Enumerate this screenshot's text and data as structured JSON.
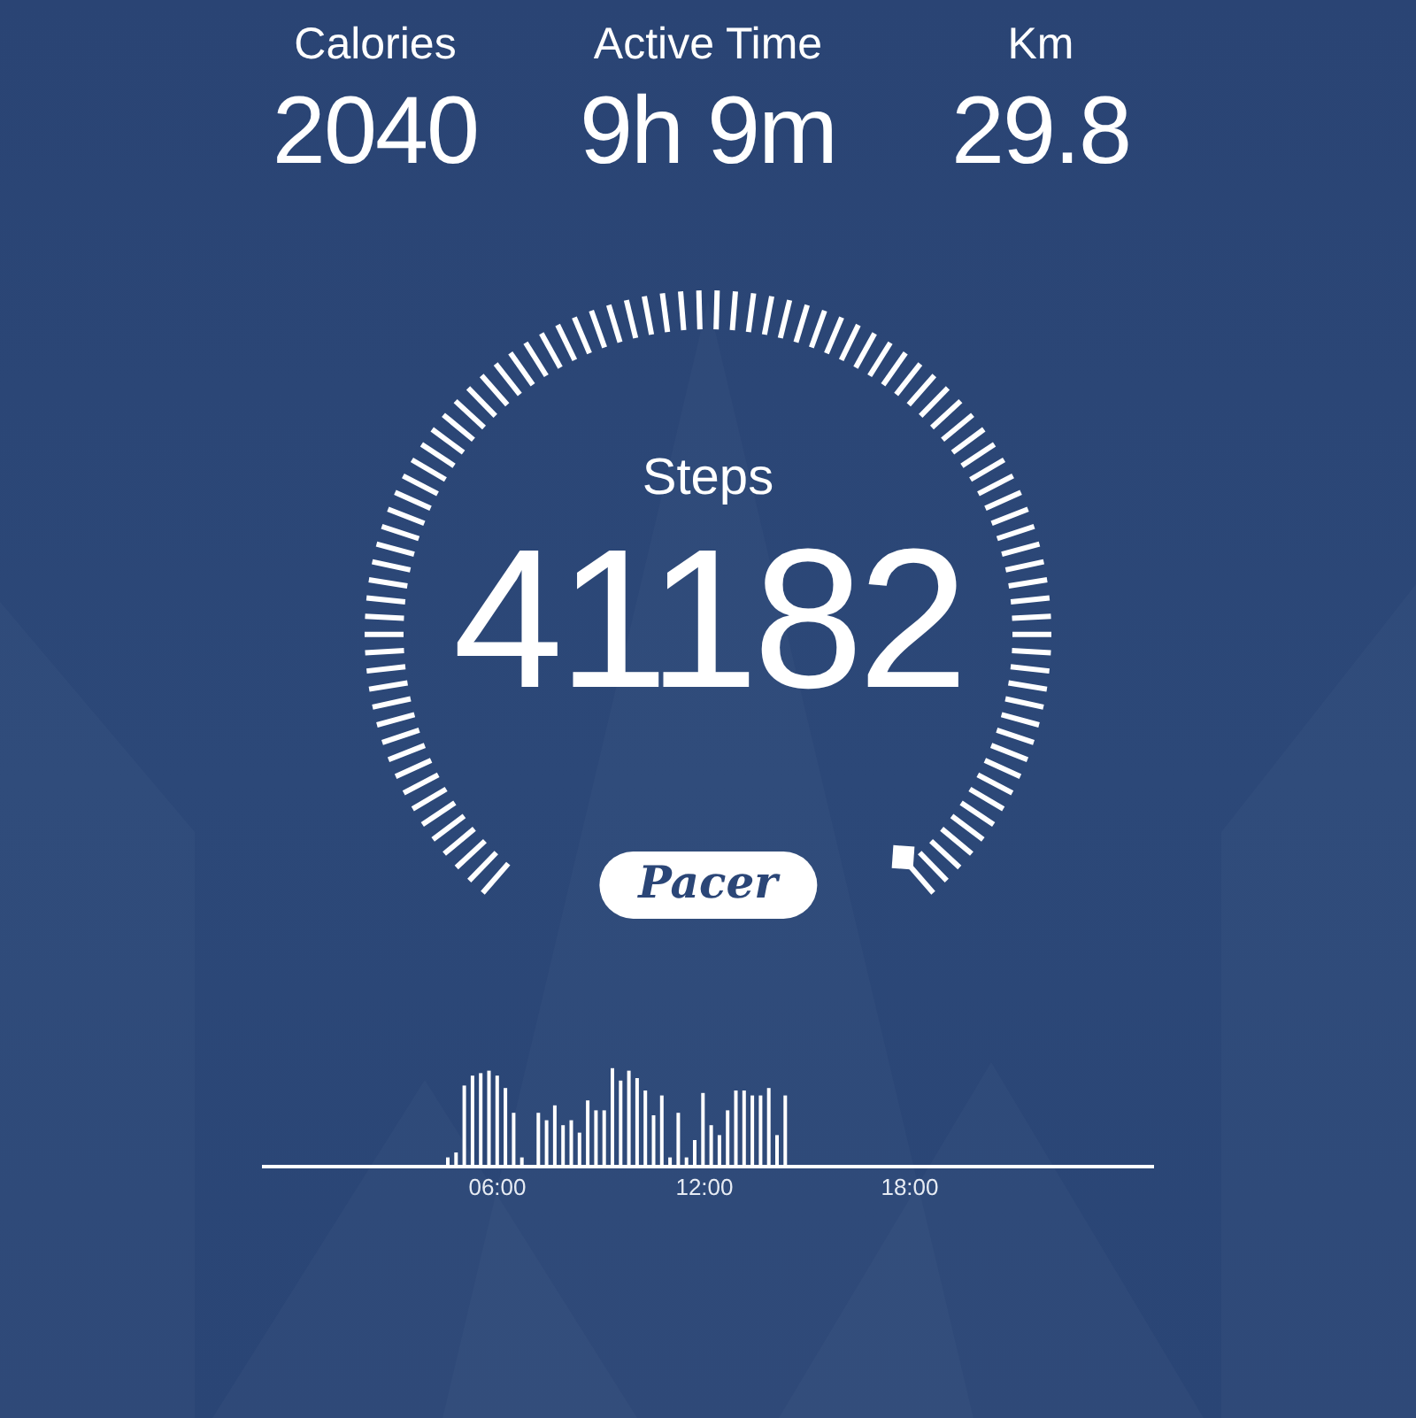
{
  "stats": [
    {
      "label": "Calories",
      "value": "2040"
    },
    {
      "label": "Active Time",
      "value": "9h 9m"
    },
    {
      "label": "Km",
      "value": "29.8"
    }
  ],
  "gauge": {
    "label": "Steps",
    "value": "41182"
  },
  "logo": {
    "text": "Pacer"
  },
  "activity_chart": {
    "time_labels": [
      "06:00",
      "12:00",
      "18:00"
    ]
  }
}
